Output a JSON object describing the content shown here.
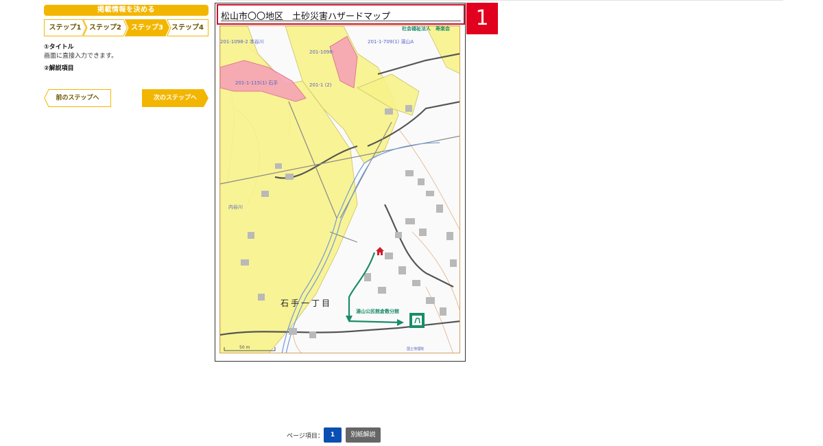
{
  "panel": {
    "header": "掲載情報を決める",
    "steps": [
      {
        "label": "ステップ1",
        "active": false
      },
      {
        "label": "ステップ2",
        "active": false
      },
      {
        "label": "ステップ3",
        "active": true
      },
      {
        "label": "ステップ4",
        "active": false
      }
    ],
    "info": {
      "item1_title": "①タイトル",
      "item1_desc": "画面に直接入力できます。",
      "item2_title": "②解説項目"
    },
    "prev_button": "前のステップへ",
    "next_button": "次のステップへ"
  },
  "preview": {
    "title": "松山市〇〇地区　土砂災害ハザードマップ",
    "badge": "1",
    "map": {
      "org_label": "社会福祉法人　寿楽会",
      "parcel_labels": [
        "201-1098-2 本谷川",
        "201-1098-",
        "201-1-709(1) 湯山A",
        "201-1-115(1) 石手",
        "201-1 (2)",
        "内谷川"
      ],
      "district_label": "石手一丁目",
      "shelter_label": "湯山公民館倉敷分館",
      "scale_label": "50 m",
      "attribution": "国土地理院"
    }
  },
  "footer": {
    "page_label": "ページ項目：",
    "page_number": "1",
    "sub_button": "別紙解説"
  },
  "colors": {
    "accent": "#f3b600",
    "hazard_yellow": "#f7f28a",
    "hazard_pink": "#f4a3b4",
    "badge_red": "#e1001e",
    "route_green": "#1a8c6a",
    "page_button_blue": "#0b4fb3"
  }
}
